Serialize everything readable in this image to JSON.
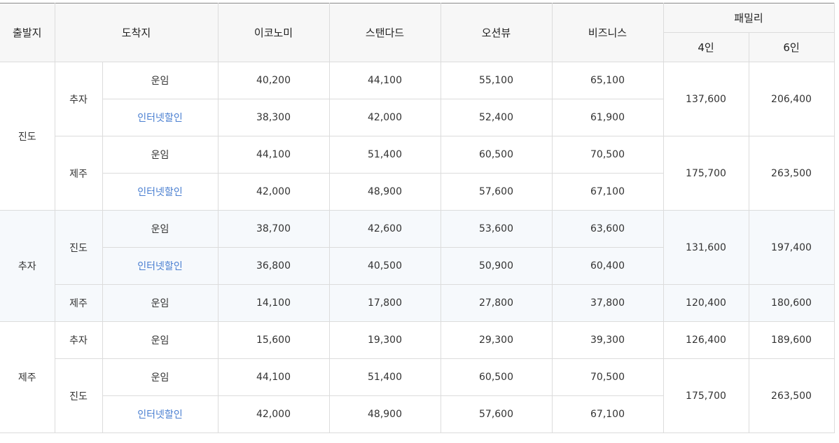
{
  "headers": {
    "origin": "출발지",
    "destination": "도착지",
    "economy": "이코노미",
    "standard": "스탠다드",
    "oceanview": "오션뷰",
    "business": "비즈니스",
    "family": "패밀리",
    "family_4": "4인",
    "family_6": "6인"
  },
  "fare_types": {
    "regular": "운임",
    "internet": "인터넷할인"
  },
  "groups": [
    {
      "origin": "진도",
      "destinations": [
        {
          "name": "추자",
          "rows": [
            {
              "type": "운임",
              "economy": "40,200",
              "standard": "44,100",
              "oceanview": "55,100",
              "business": "65,100"
            },
            {
              "type": "인터넷할인",
              "economy": "38,300",
              "standard": "42,000",
              "oceanview": "52,400",
              "business": "61,900"
            }
          ],
          "family_4": "137,600",
          "family_6": "206,400"
        },
        {
          "name": "제주",
          "rows": [
            {
              "type": "운임",
              "economy": "44,100",
              "standard": "51,400",
              "oceanview": "60,500",
              "business": "70,500"
            },
            {
              "type": "인터넷할인",
              "economy": "42,000",
              "standard": "48,900",
              "oceanview": "57,600",
              "business": "67,100"
            }
          ],
          "family_4": "175,700",
          "family_6": "263,500"
        }
      ]
    },
    {
      "origin": "추자",
      "destinations": [
        {
          "name": "진도",
          "rows": [
            {
              "type": "운임",
              "economy": "38,700",
              "standard": "42,600",
              "oceanview": "53,600",
              "business": "63,600"
            },
            {
              "type": "인터넷할인",
              "economy": "36,800",
              "standard": "40,500",
              "oceanview": "50,900",
              "business": "60,400"
            }
          ],
          "family_4": "131,600",
          "family_6": "197,400"
        },
        {
          "name": "제주",
          "rows": [
            {
              "type": "운임",
              "economy": "14,100",
              "standard": "17,800",
              "oceanview": "27,800",
              "business": "37,800"
            }
          ],
          "family_4": "120,400",
          "family_6": "180,600"
        }
      ]
    },
    {
      "origin": "제주",
      "destinations": [
        {
          "name": "추자",
          "rows": [
            {
              "type": "운임",
              "economy": "15,600",
              "standard": "19,300",
              "oceanview": "29,300",
              "business": "39,300"
            }
          ],
          "family_4": "126,400",
          "family_6": "189,600"
        },
        {
          "name": "진도",
          "rows": [
            {
              "type": "운임",
              "economy": "44,100",
              "standard": "51,400",
              "oceanview": "60,500",
              "business": "70,500"
            },
            {
              "type": "인터넷할인",
              "economy": "42,000",
              "standard": "48,900",
              "oceanview": "57,600",
              "business": "67,100"
            }
          ],
          "family_4": "175,700",
          "family_6": "263,500"
        }
      ]
    }
  ]
}
